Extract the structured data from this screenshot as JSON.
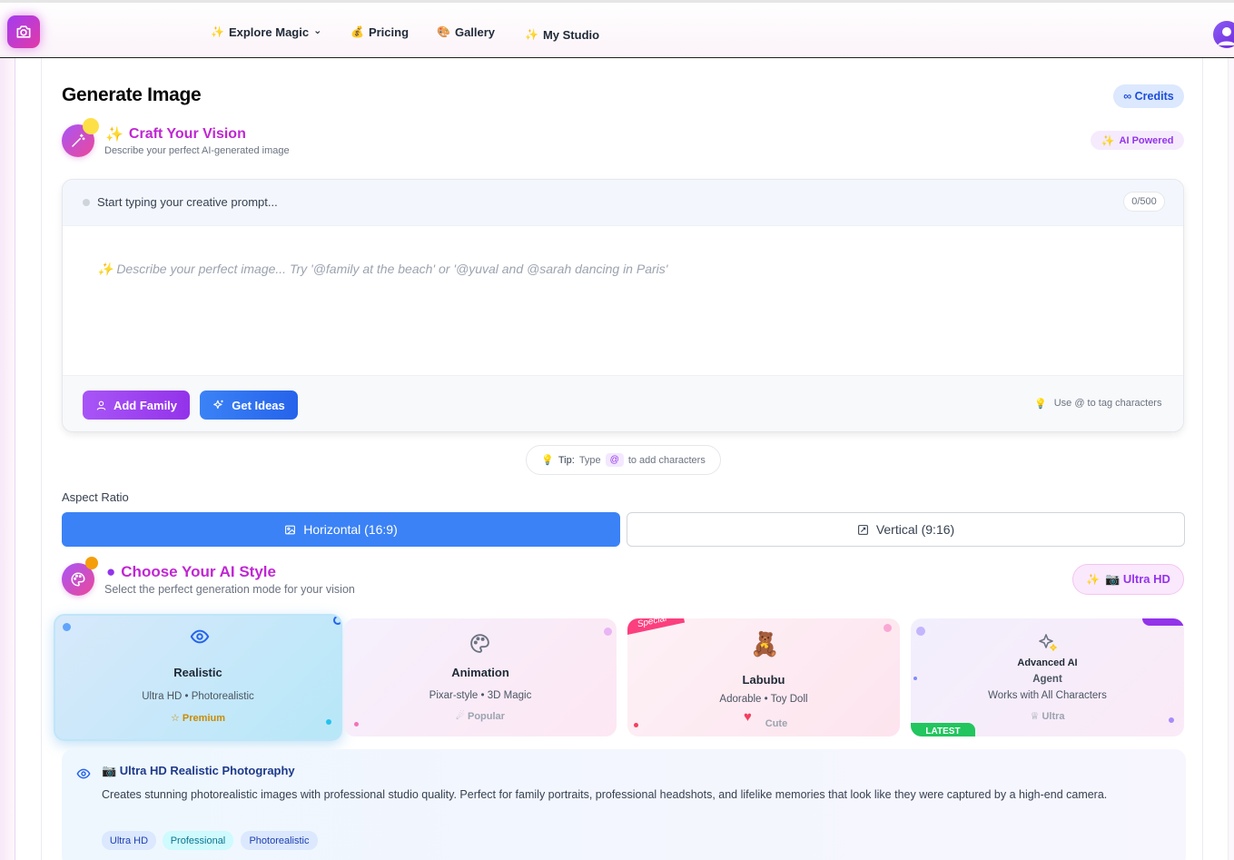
{
  "nav": {
    "items": [
      {
        "emoji": "✨",
        "label": "Explore Magic",
        "chevron": "⌄"
      },
      {
        "emoji": "💰",
        "label": "Pricing"
      },
      {
        "emoji": "🎨",
        "label": "Gallery"
      },
      {
        "emoji": "✨",
        "label": "My Studio"
      }
    ]
  },
  "page": {
    "title": "Generate Image",
    "credits": "∞ Credits"
  },
  "vision": {
    "title": "Craft Your Vision",
    "subtitle": "Describe your perfect AI-generated image",
    "badge": "AI Powered"
  },
  "prompt": {
    "label": "Start typing your creative prompt...",
    "counter": "0/500",
    "placeholder": "✨ Describe your perfect image... Try '@family at the beach' or '@yuval and @sarah dancing in Paris'",
    "add_family": "Add Family",
    "get_ideas": "Get Ideas",
    "tag_hint": "Use @ to tag characters"
  },
  "tip": {
    "prefix": "Tip:",
    "type": "Type",
    "at": "@",
    "suffix": "to add characters"
  },
  "aspect": {
    "label": "Aspect Ratio",
    "horizontal": "Horizontal (16:9)",
    "vertical": "Vertical (9:16)",
    "selected": "horizontal"
  },
  "style": {
    "title": "Choose Your AI Style",
    "subtitle": "Select the perfect generation mode for your vision",
    "badge": "📷 Ultra HD",
    "cards": [
      {
        "title": "Realistic",
        "sub": "Ultra HD • Photorealistic",
        "badge": "Premium",
        "badge_icon": "☆"
      },
      {
        "title": "Animation",
        "sub": "Pixar-style • 3D Magic",
        "badge": "Popular",
        "badge_icon": "☄"
      },
      {
        "title": "Labubu",
        "sub": "Adorable • Toy Doll",
        "badge": "Cute",
        "ribbon": "Special",
        "emoji": "🧸"
      },
      {
        "title": "Advanced AI",
        "title2": "Agent",
        "sub": "Works with All Characters",
        "badge": "Ultra",
        "badge_icon": "♕",
        "corner": "LATEST"
      }
    ]
  },
  "detail": {
    "title": "📷 Ultra HD Realistic Photography",
    "text": "Creates stunning photorealistic images with professional studio quality. Perfect for family portraits, professional headshots, and lifelike memories that look like they were captured by a high-end camera.",
    "chips": [
      "Ultra HD",
      "Professional",
      "Photorealistic"
    ]
  },
  "colors": {
    "accent_blue": "#3b82f6",
    "accent_purple": "#a855f7",
    "accent_pink": "#c026d3"
  }
}
